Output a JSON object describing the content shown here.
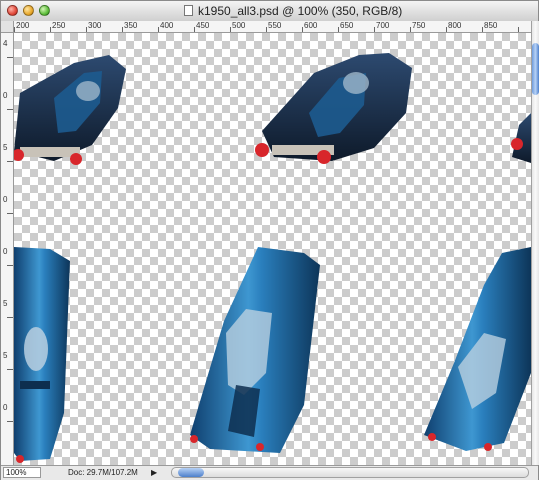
{
  "window": {
    "title": "k1950_all3.psd @ 100% (350, RGB/8)"
  },
  "ruler_h": {
    "labels": [
      "200",
      "250",
      "300",
      "350",
      "400",
      "450",
      "500",
      "550",
      "600",
      "650",
      "700",
      "750",
      "800",
      "850"
    ]
  },
  "ruler_v": {
    "labels": [
      "4",
      "0",
      "5",
      "0",
      "0",
      "5",
      "5",
      "0"
    ]
  },
  "statusbar": {
    "zoom": "100%",
    "doc_size": "Doc: 29.7M/107.2M"
  },
  "colors": {
    "car_blue": "#1f6fa8",
    "car_dark": "#1b2d45",
    "taillight": "#d8262b",
    "scroll_accent": "#4c7fcb"
  }
}
